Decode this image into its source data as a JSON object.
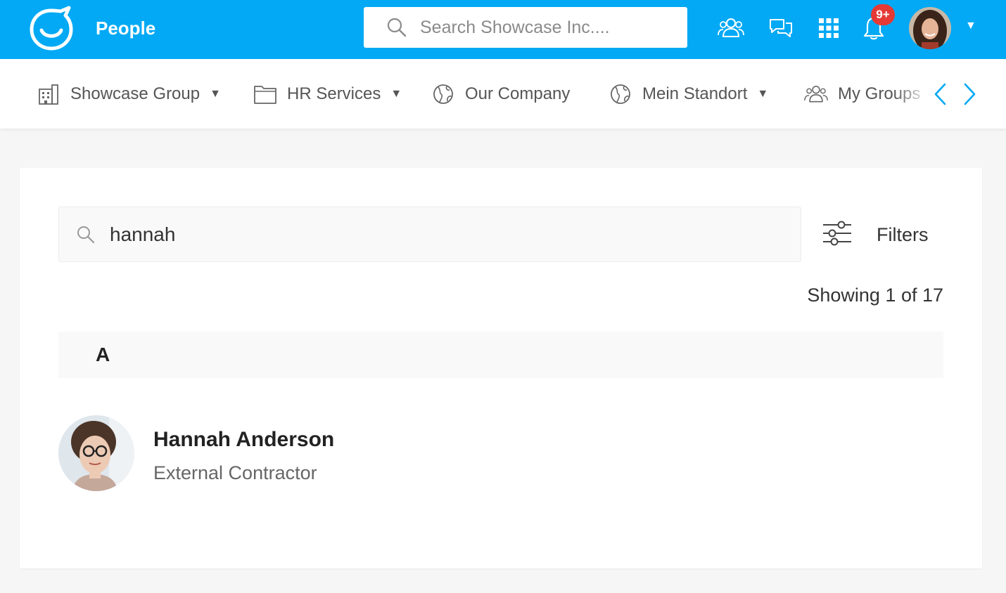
{
  "header": {
    "app_title": "People",
    "search_placeholder": "Search Showcase Inc....",
    "notification_badge": "9+",
    "brand_color": "#03a9f4",
    "icons": [
      "logo-icon",
      "groups-icon",
      "chat-icon",
      "apps-grid-icon",
      "bell-icon",
      "profile-avatar",
      "caret-down-icon"
    ]
  },
  "nav": {
    "items": [
      {
        "label": "Showcase Group",
        "icon": "building-icon",
        "has_dropdown": true
      },
      {
        "label": "HR Services",
        "icon": "folder-icon",
        "has_dropdown": true
      },
      {
        "label": "Our Company",
        "icon": "globe-icon",
        "has_dropdown": false
      },
      {
        "label": "Mein Standort",
        "icon": "globe-icon",
        "has_dropdown": true
      },
      {
        "label": "My Groups",
        "icon": "groups-icon",
        "has_dropdown": false
      }
    ]
  },
  "directory": {
    "search_value": "hannah",
    "filters_label": "Filters",
    "showing_text": "Showing 1 of 17",
    "sections": [
      {
        "letter": "A",
        "people": [
          {
            "name": "Hannah Anderson",
            "role": "External Contractor"
          }
        ]
      }
    ]
  }
}
